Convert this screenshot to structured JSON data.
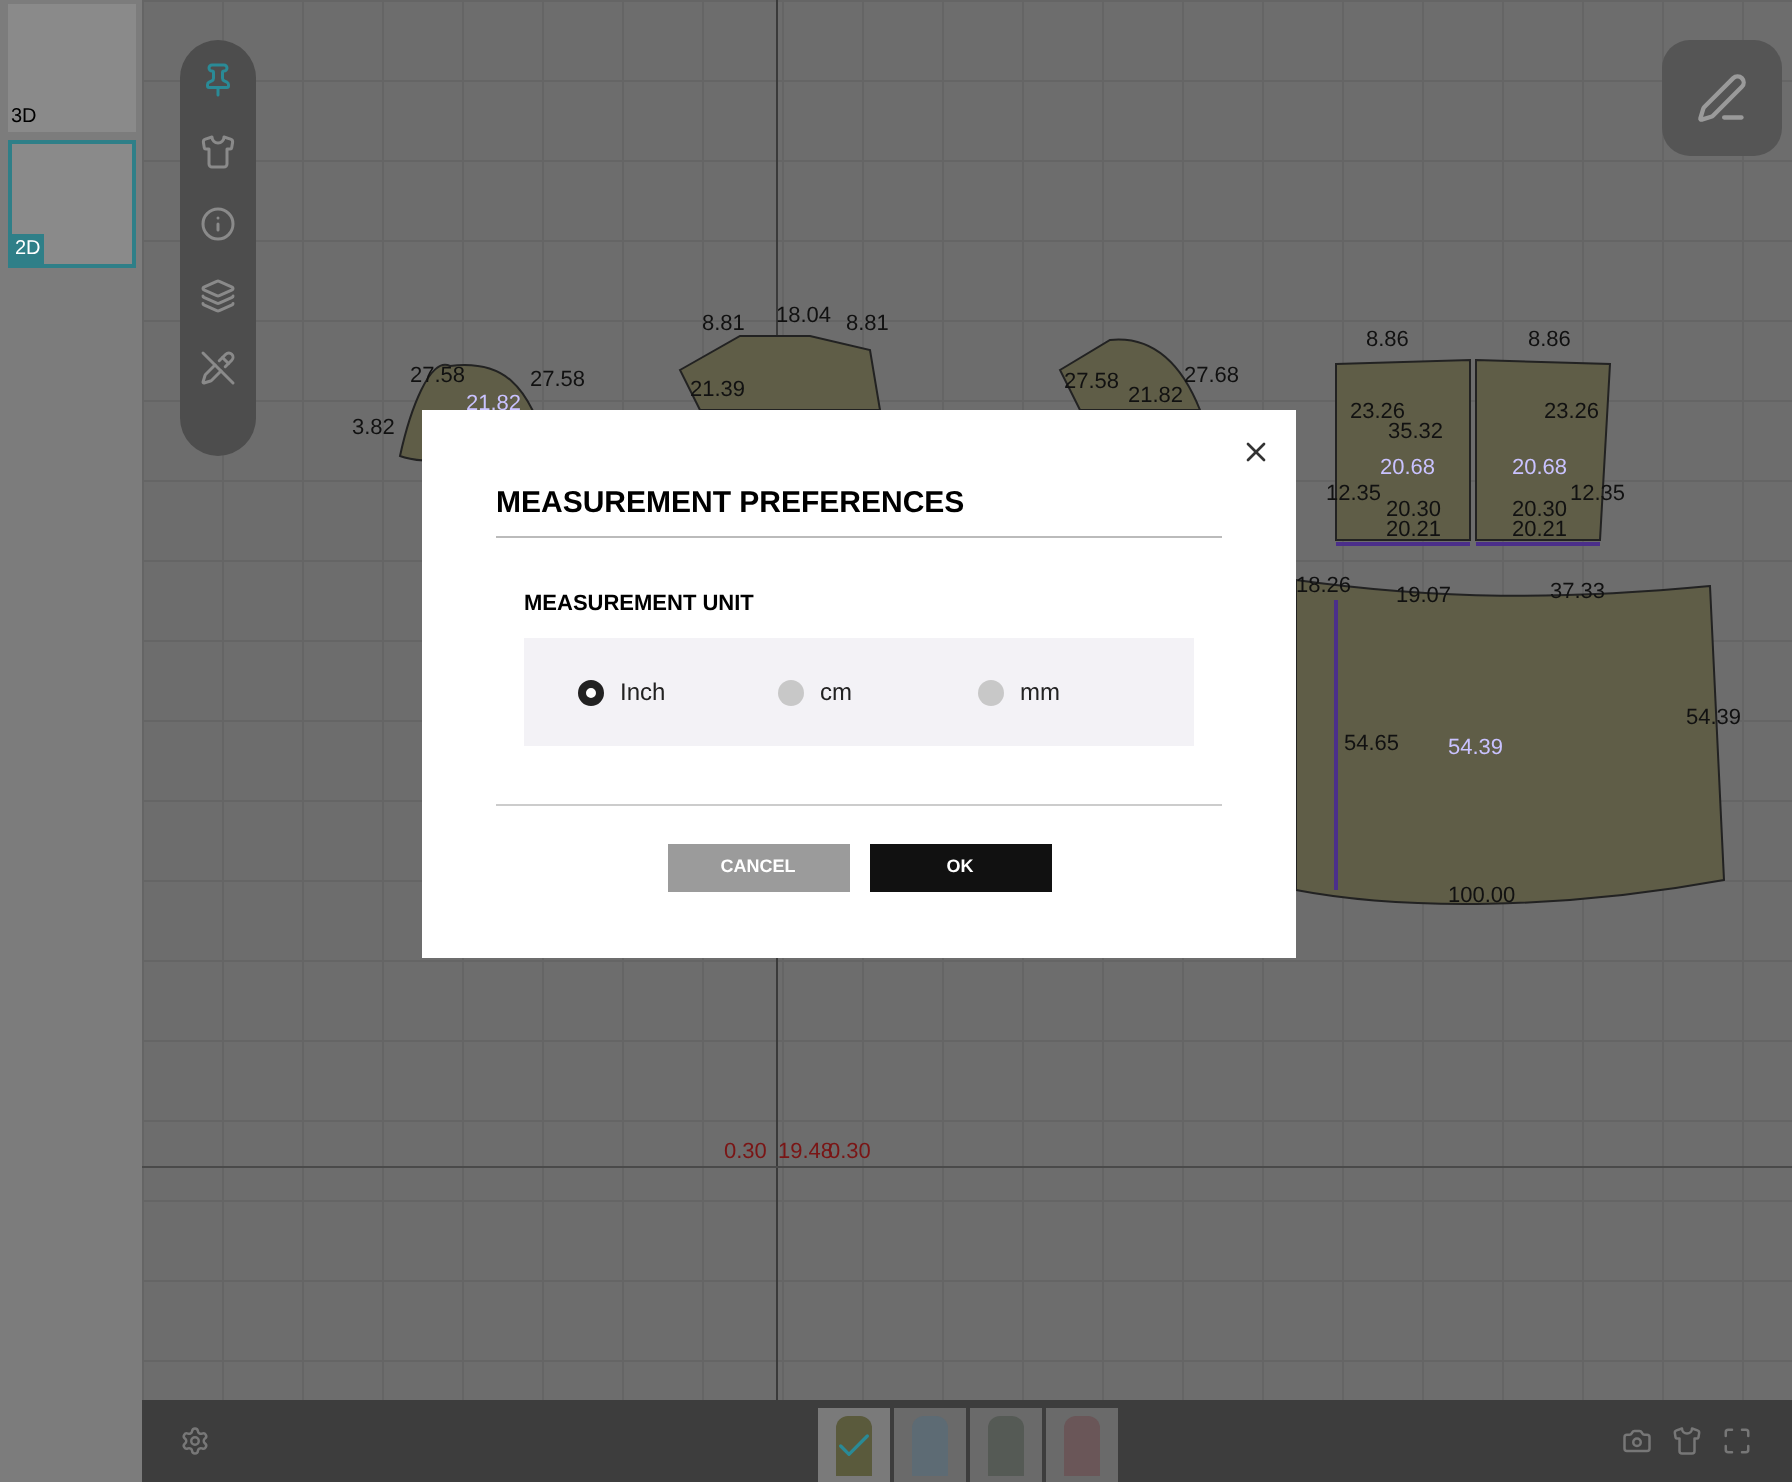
{
  "sidebar": {
    "views": [
      {
        "label": "3D",
        "selected": false
      },
      {
        "label": "2D",
        "selected": true
      }
    ]
  },
  "toolbar": {
    "tools": [
      {
        "kind": "pin",
        "selected": true
      },
      {
        "kind": "garment",
        "selected": false
      },
      {
        "kind": "info",
        "selected": false
      },
      {
        "kind": "fabric",
        "selected": false
      },
      {
        "kind": "hide-measure",
        "selected": false
      }
    ]
  },
  "canvas": {
    "measurements": [
      {
        "text": "27.58",
        "kind": "length"
      },
      {
        "text": "27.58",
        "kind": "length"
      },
      {
        "text": "21.82",
        "kind": "guide"
      },
      {
        "text": "3.82",
        "kind": "length"
      },
      {
        "text": "8.81",
        "kind": "length"
      },
      {
        "text": "18.04",
        "kind": "length"
      },
      {
        "text": "8.81",
        "kind": "length"
      },
      {
        "text": "21.39",
        "kind": "length"
      },
      {
        "text": "27.58",
        "kind": "length"
      },
      {
        "text": "21.82",
        "kind": "length"
      },
      {
        "text": "27.68",
        "kind": "length"
      },
      {
        "text": "8.86",
        "kind": "length"
      },
      {
        "text": "8.86",
        "kind": "length"
      },
      {
        "text": "23.26",
        "kind": "length"
      },
      {
        "text": "23.26",
        "kind": "length"
      },
      {
        "text": "35.32",
        "kind": "length"
      },
      {
        "text": "20.68",
        "kind": "guide"
      },
      {
        "text": "20.68",
        "kind": "guide"
      },
      {
        "text": "12.35",
        "kind": "length"
      },
      {
        "text": "12.35",
        "kind": "length"
      },
      {
        "text": "20.30",
        "kind": "length"
      },
      {
        "text": "20.30",
        "kind": "length"
      },
      {
        "text": "20.21",
        "kind": "length"
      },
      {
        "text": "20.21",
        "kind": "length"
      },
      {
        "text": "18.26",
        "kind": "length"
      },
      {
        "text": "19.07",
        "kind": "length"
      },
      {
        "text": "37.33",
        "kind": "length"
      },
      {
        "text": "54.39",
        "kind": "length"
      },
      {
        "text": "54.65",
        "kind": "length"
      },
      {
        "text": "54.39",
        "kind": "guide"
      },
      {
        "text": "100.00",
        "kind": "length"
      },
      {
        "text": "0.30",
        "kind": "seam"
      },
      {
        "text": "19.48",
        "kind": "seam"
      },
      {
        "text": "0.30",
        "kind": "seam"
      }
    ]
  },
  "dialog": {
    "title": "MEASUREMENT PREFERENCES",
    "section": "MEASUREMENT UNIT",
    "options": [
      {
        "label": "Inch",
        "selected": true
      },
      {
        "label": "cm",
        "selected": false
      },
      {
        "label": "mm",
        "selected": false
      }
    ],
    "buttons": [
      {
        "label": "CANCEL",
        "kind": "secondary"
      },
      {
        "label": "OK",
        "kind": "primary"
      }
    ]
  },
  "colorways": [
    {
      "color": "#5a5a3c",
      "selected": true
    },
    {
      "color": "#5d6b74",
      "selected": false
    },
    {
      "color": "#555a55",
      "selected": false
    },
    {
      "color": "#6a5658",
      "selected": false
    }
  ]
}
